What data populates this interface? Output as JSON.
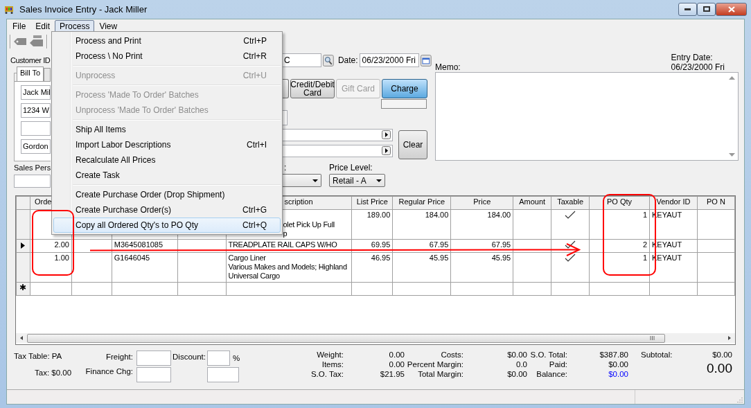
{
  "window": {
    "title": "Sales Invoice Entry - Jack Miller"
  },
  "menu_bar": [
    {
      "label": "File",
      "selected": false
    },
    {
      "label": "Edit",
      "selected": false
    },
    {
      "label": "Process",
      "selected": true
    },
    {
      "label": "View",
      "selected": false
    }
  ],
  "process_menu": [
    [
      {
        "label": "Process and Print",
        "shortcut": "Ctrl+P",
        "disabled": false,
        "highlighted": false
      },
      {
        "label": "Process \\ No Print",
        "shortcut": "Ctrl+R",
        "disabled": false,
        "highlighted": false
      }
    ],
    [
      {
        "label": "Unprocess",
        "shortcut": "Ctrl+U",
        "disabled": true,
        "highlighted": false
      }
    ],
    [
      {
        "label": "Process 'Made To Order' Batches",
        "disabled": true,
        "highlighted": false
      },
      {
        "label": "Unprocess 'Made To Order' Batches",
        "disabled": true,
        "highlighted": false
      }
    ],
    [
      {
        "label": "Ship All Items",
        "disabled": false,
        "highlighted": false
      },
      {
        "label": "Import Labor Descriptions",
        "shortcut": "Ctrl+I",
        "disabled": false,
        "highlighted": false
      },
      {
        "label": "Recalculate All Prices",
        "disabled": false,
        "highlighted": false
      },
      {
        "label": "Create Task",
        "disabled": false,
        "highlighted": false
      }
    ],
    [
      {
        "label": "Create Purchase Order (Drop Shipment)",
        "disabled": false,
        "highlighted": false
      },
      {
        "label": "Create Purchase Order(s)",
        "shortcut": "Ctrl+G",
        "disabled": false,
        "highlighted": false
      },
      {
        "label": "Copy all Ordered Qty's to PO Qty",
        "shortcut": "Ctrl+Q",
        "disabled": false,
        "highlighted": true
      }
    ]
  ],
  "customer": {
    "label": "Customer ID",
    "value": "C",
    "tabs": [
      {
        "label": "Bill To",
        "selected": true
      },
      {
        "selected": false
      }
    ],
    "address": {
      "name": "Jack Mil",
      "street": "1234 W",
      "city": "Gordon"
    }
  },
  "date": {
    "label": "Date:",
    "value": "06/23/2000 Fri"
  },
  "payment_buttons": [
    {
      "kind": "partial"
    },
    {
      "kind": "full",
      "label": "Credit/Debit Card",
      "disabled": false,
      "selected": false
    },
    {
      "kind": "full",
      "label": "Gift Card",
      "disabled": true,
      "selected": false
    },
    {
      "kind": "full",
      "label": "Charge",
      "disabled": false,
      "selected": true
    }
  ],
  "clear_button": "Clear",
  "memo": {
    "label": "Memo:"
  },
  "entry_date": {
    "label": "Entry Date:",
    "value": "06/23/2000 Fri"
  },
  "sales_person": {
    "label": "Sales Pers"
  },
  "dropdown_2": {
    "label": ":"
  },
  "price_level": {
    "label": "Price Level:",
    "value": "Retail - A"
  },
  "table": {
    "columns": [
      "Orde",
      "scription",
      "List Price",
      "Regular Price",
      "Price",
      "Amount",
      "Taxable",
      "PO Qty",
      "Vendor ID",
      "PO N"
    ],
    "rows": [
      {
        "current": false,
        "description": "olet Pick Up Full\np",
        "list_price": "189.00",
        "regular_price": "184.00",
        "price": "184.00",
        "taxable": true,
        "po_qty": "1",
        "vendor_id": "KEYAUT"
      },
      {
        "current": true,
        "order": "2.00",
        "column_3": "M3645081085",
        "description": "TREADPLATE RAIL CAPS W/HO",
        "list_price": "69.95",
        "regular_price": "67.95",
        "price": "67.95",
        "taxable": true,
        "po_qty": "2",
        "vendor_id": "KEYAUT"
      },
      {
        "current": false,
        "order": "1.00",
        "column_3": "G1646045",
        "description": "Cargo Liner\nVarious Makes and Models; Highland\nUniversal Cargo",
        "list_price": "46.95",
        "regular_price": "45.95",
        "price": "45.95",
        "taxable": true,
        "po_qty": "1",
        "vendor_id": "KEYAUT"
      }
    ],
    "new_row_marker": "✱"
  },
  "totals": {
    "tax_table": "Tax Table: PA",
    "tax": "Tax: $0.00",
    "freight_label": "Freight:",
    "finance_label": "Finance Chg:",
    "discount_label": "Discount:",
    "percent_sign": "%",
    "columns": [
      [
        {
          "label": "Weight:",
          "value": "0.00"
        },
        {
          "label": "Items:",
          "value": "0.00"
        },
        {
          "label": "S.O. Tax:",
          "value": "$21.95"
        }
      ],
      [
        {
          "label": "Costs:",
          "value": "$0.00"
        },
        {
          "label": "Percent Margin:",
          "value": "0.0"
        },
        {
          "label": "Total Margin:",
          "value": "$0.00"
        }
      ],
      [
        {
          "label": "S.O. Total:",
          "value": "$387.80"
        },
        {
          "label": "Paid:",
          "value": "$0.00"
        },
        {
          "label": "Balance:",
          "value": "$0.00",
          "color": "#0000ff"
        }
      ]
    ],
    "subtotal_label": "Subtotal:",
    "subtotal_value": "$0.00",
    "grand_total": "0.00"
  }
}
